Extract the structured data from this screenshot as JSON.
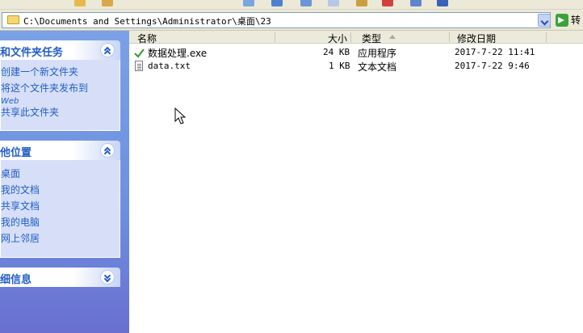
{
  "address": {
    "path": "C:\\Documents and Settings\\Administrator\\桌面\\23",
    "go_label": "转"
  },
  "taskpane": {
    "file_tasks": {
      "title": "和文件夹任务",
      "items": [
        {
          "label": "创建一个新文件夹"
        },
        {
          "label": "将这个文件夹发布到",
          "sub": "Web"
        },
        {
          "label": "共享此文件夹"
        }
      ]
    },
    "other_places": {
      "title": "他位置",
      "items": [
        {
          "label": "桌面"
        },
        {
          "label": "我的文档"
        },
        {
          "label": "共享文档"
        },
        {
          "label": "我的电脑"
        },
        {
          "label": "网上邻居"
        }
      ]
    },
    "details": {
      "title": "细信息"
    }
  },
  "filelist": {
    "columns": {
      "name": "名称",
      "size": "大小",
      "type": "类型",
      "modified": "修改日期"
    },
    "rows": [
      {
        "icon": "exe-checkmark-icon",
        "name": "数据处理.exe",
        "size": "24 KB",
        "type": "应用程序",
        "modified": "2017-7-22 11:41"
      },
      {
        "icon": "text-file-icon",
        "name": "data.txt",
        "size": "1 KB",
        "type": "文本文档",
        "modified": "2017-7-22 9:46"
      }
    ]
  },
  "colors": {
    "taskpane_link": "#215dc6",
    "taskpane_bg": "#6d8fe0",
    "panel_body": "#d6dff7",
    "address_border": "#7f9db9"
  }
}
